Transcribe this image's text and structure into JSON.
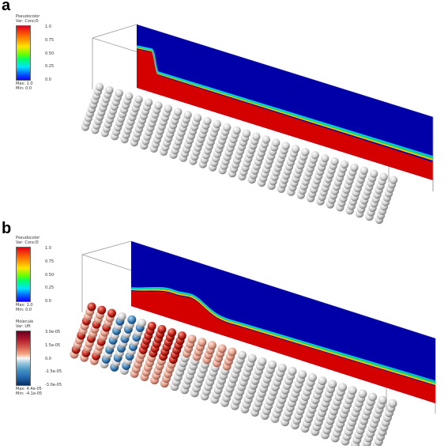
{
  "panel_a": {
    "letter": "a",
    "legend": {
      "title1": "Pseudocolor",
      "title2": "Var: Conc/0",
      "ticks": [
        "1.0",
        "0.75",
        "0.50",
        "0.25",
        "0.0"
      ],
      "max": "Max:  1.0",
      "min": "Min:  0.0"
    }
  },
  "panel_b": {
    "letter": "b",
    "legend_conc": {
      "title1": "Pseudocolor",
      "title2": "Var: Conc/0",
      "ticks": [
        "1.0",
        "0.75",
        "0.50",
        "0.25",
        "0.0"
      ],
      "max": "Max:  1.0",
      "min": "Min:  0.0"
    },
    "legend_mol": {
      "title1": "Molecule",
      "title2": "Var: Uft",
      "ticks": [
        "3.0e-05",
        "1.5e-05",
        "0.0",
        "-1.5e-05",
        "-3.0e-05"
      ],
      "max": "Max:  4.4e-05",
      "min": "Min: -4.1e-05"
    }
  },
  "colors": {
    "field_blue": "#0000a8",
    "front_red": "#d40000",
    "sphere_grey": "#d9d9d9"
  }
}
